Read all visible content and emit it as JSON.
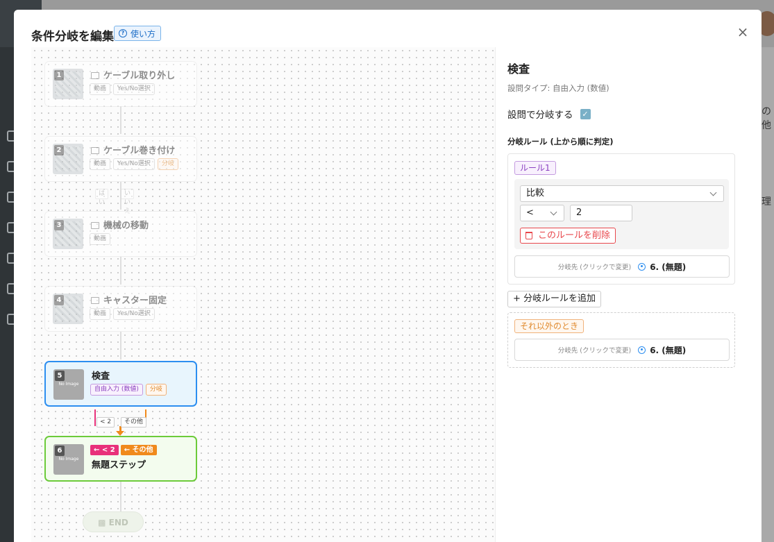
{
  "modal": {
    "title": "条件分岐を編集",
    "help_label": "使い方",
    "close_label": "×"
  },
  "flow": {
    "steps": [
      {
        "num": "1",
        "title": "ケーブル取り外し",
        "tags": [
          "動画",
          "Yes/No選択"
        ],
        "state": "faded"
      },
      {
        "num": "2",
        "title": "ケーブル巻き付け",
        "tags": [
          "動画",
          "Yes/No選択",
          "分岐"
        ],
        "branches": [
          "はい",
          "いいえ"
        ],
        "state": "faded"
      },
      {
        "num": "3",
        "title": "機械の移動",
        "tags": [
          "動画"
        ],
        "state": "faded"
      },
      {
        "num": "4",
        "title": "キャスター固定",
        "tags": [
          "動画",
          "Yes/No選択"
        ],
        "state": "faded"
      },
      {
        "num": "5",
        "title": "検査",
        "tags": [
          "自由入力 (数値)",
          "分岐"
        ],
        "branches": [
          "< 2",
          "その他"
        ],
        "state": "active",
        "image_text": "No Image"
      },
      {
        "num": "6",
        "title": "無題ステップ",
        "incoming": [
          "← < 2",
          "← その他"
        ],
        "state": "target",
        "image_text": "No Image"
      }
    ],
    "end_label": "END"
  },
  "panel": {
    "title": "検査",
    "question_type": "設問タイプ: 自由入力 (数値)",
    "branch_by_question_label": "設問で分岐する",
    "branch_by_question_checked": true,
    "rules_heading": "分岐ルール (上から順に判定)",
    "rules": [
      {
        "label": "ルール1",
        "mode": "比較",
        "operator": "<",
        "value": "2",
        "delete_label": "このルールを削除",
        "dest_hint": "分岐先 (クリックで変更)",
        "dest_value": "6. (無題)"
      }
    ],
    "add_rule_label": "+ 分岐ルールを追加",
    "else": {
      "label": "それ以外のとき",
      "dest_hint": "分岐先 (クリックで変更)",
      "dest_value": "6. (無題)"
    }
  },
  "background": {
    "right_snippets": [
      "の他",
      "理"
    ]
  },
  "colors": {
    "active_border": "#2c8ef0",
    "target_border": "#6ccb3a",
    "branch_pink": "#e8317a",
    "branch_orange": "#f08a1c",
    "danger": "#e8474c"
  }
}
